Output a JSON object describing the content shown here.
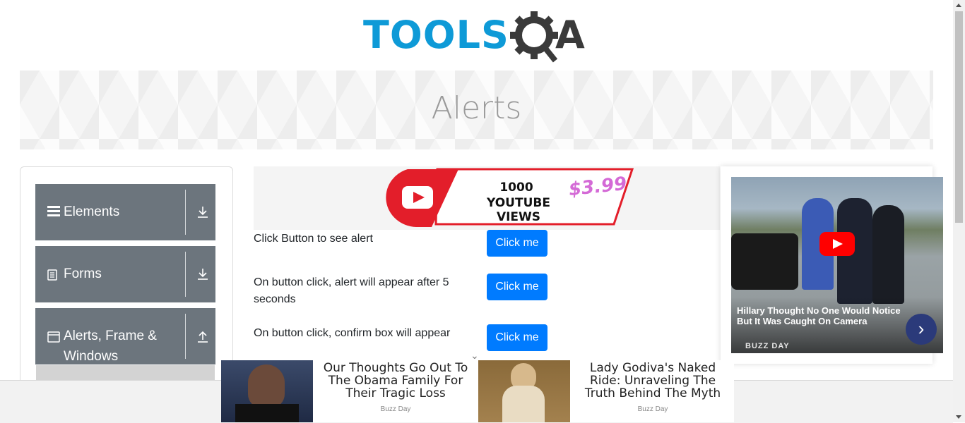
{
  "header": {
    "logo_text": "TOOLS",
    "logo_suffix": "A"
  },
  "banner": {
    "title": "Alerts"
  },
  "sidebar": {
    "groups": [
      {
        "label": "Elements",
        "icon": "hamburger-icon",
        "toggle_icon": "download-arrow-icon"
      },
      {
        "label": "Forms",
        "icon": "document-icon",
        "toggle_icon": "download-arrow-icon"
      },
      {
        "label": "Alerts, Frame &",
        "label2": "Windows",
        "icon": "window-icon",
        "toggle_icon": "upload-arrow-icon"
      }
    ]
  },
  "ad_top": {
    "line1": "1000",
    "line2": "YOUTUBE VIEWS",
    "price": "$3.99"
  },
  "alerts": [
    {
      "text": "Click Button to see alert",
      "button": "Click me"
    },
    {
      "text": "On button click, alert will appear after 5 seconds",
      "button": "Click me"
    },
    {
      "text": "On button click, confirm box will appear",
      "button": "Click me"
    }
  ],
  "video_ad": {
    "caption": "Hillary Thought No One Would Notice But It Was Caught On Camera",
    "brand": "BUZZ DAY"
  },
  "sticky_ads": [
    {
      "headline": "Our Thoughts Go Out To The Obama Family For Their Tragic Loss",
      "source": "Buzz Day"
    },
    {
      "headline": "Lady Godiva's Naked Ride: Unraveling The Truth Behind The Myth",
      "source": "Buzz Day"
    }
  ],
  "colors": {
    "primary_button": "#007bff",
    "sidebar_group": "#6c757d",
    "logo_blue": "#0e9ad7"
  }
}
